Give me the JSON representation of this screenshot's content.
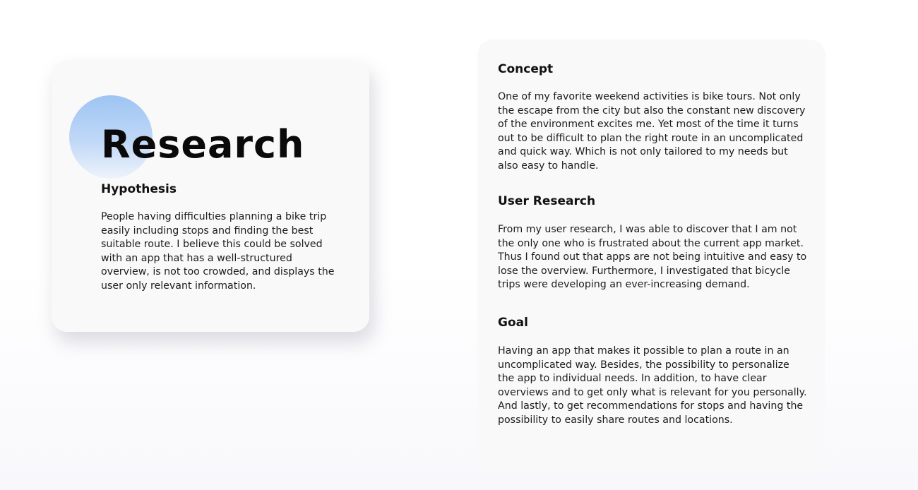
{
  "research_card": {
    "title": "Research",
    "hypothesis": {
      "heading": "Hypothesis",
      "body": "People having difficulties planning a bike trip easily including stops and finding the best suitable route. I believe this could be solved with an app that has a well-structured overview, is not too crowded, and displays the user only relevant information."
    }
  },
  "details_card": {
    "sections": [
      {
        "heading": "Concept",
        "body": "One of my favorite weekend activities is bike tours. Not only the escape from the city but also the constant new discovery of the environment excites me. Yet most of the time it turns out to be difficult to plan the right route in an uncomplicated and quick way. Which is not only tailored to my needs but also easy to handle."
      },
      {
        "heading": "User Research",
        "body": "From my user research, I was able to discover that I am not the only one who is frustrated about the current app market. Thus I found out that apps are not being intuitive and easy to lose the overview. Furthermore, I investigated that bicycle trips were developing an ever-increasing demand."
      },
      {
        "heading": "Goal",
        "body": "Having an app that makes it possible to plan a route in an uncomplicated way. Besides, the possibility to personalize the app to individual needs. In addition, to have clear overviews and to get only what is relevant for you personally. And lastly, to get recommendations for stops and having the possibility to easily share routes and locations."
      }
    ]
  },
  "colors": {
    "accent_blob": "#9ec4f3",
    "card_background": "#f9f9f9",
    "text": "#141414"
  }
}
